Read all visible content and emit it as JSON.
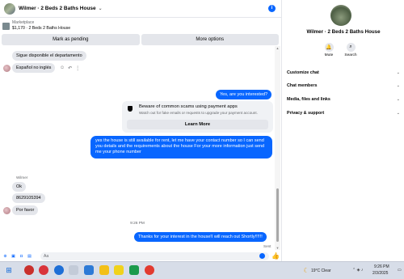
{
  "header": {
    "title": "Wilmer · 2 Beds 2 Baths House",
    "chevron_icon": "chevron-down-icon",
    "info_icon": "info-icon"
  },
  "listing": {
    "source": "Marketplace",
    "title": "$1,170 · 2 Beds 2 Baths House"
  },
  "actions": {
    "pending": "Mark as pending",
    "more": "More options"
  },
  "messages_top": {
    "in1": "Sigue disponible el departamento",
    "in2": "Español no inglés"
  },
  "out1": "Yes, are you interested?",
  "warning": {
    "title": "Beware of common scams using payment apps",
    "subtitle": "Watch out for fake emails or requests to upgrade your payment account.",
    "button": "Learn More"
  },
  "out2": "yes the house is still available for rent, let me have your contact number so I can send you details and the requirements about the house For  your  more  information  just send  me   your  phone  number",
  "sender": "Wilmer",
  "in_block": [
    "Ok",
    "8629105394",
    "Por favor"
  ],
  "timestamp": "9:26 PM",
  "out3": "Thanks for your interest in the house!I will reach out Shortly!!!!!!",
  "sent_label": "Sent",
  "composer": {
    "placeholder": "Aa"
  },
  "info": {
    "name": "Wilmer · 2 Beds 2 Baths House",
    "mute": "Mute",
    "search": "Search",
    "sections": [
      "Customize chat",
      "Chat members",
      "Media, files and links",
      "Privacy & support"
    ]
  },
  "taskbar": {
    "weather": "19°C  Clear",
    "time": "9:26 PM",
    "date": "2/3/2025"
  },
  "colors": {
    "accent": "#0866ff",
    "bubble_in": "#e4e6eb",
    "taskbar": "#d7dde8"
  }
}
